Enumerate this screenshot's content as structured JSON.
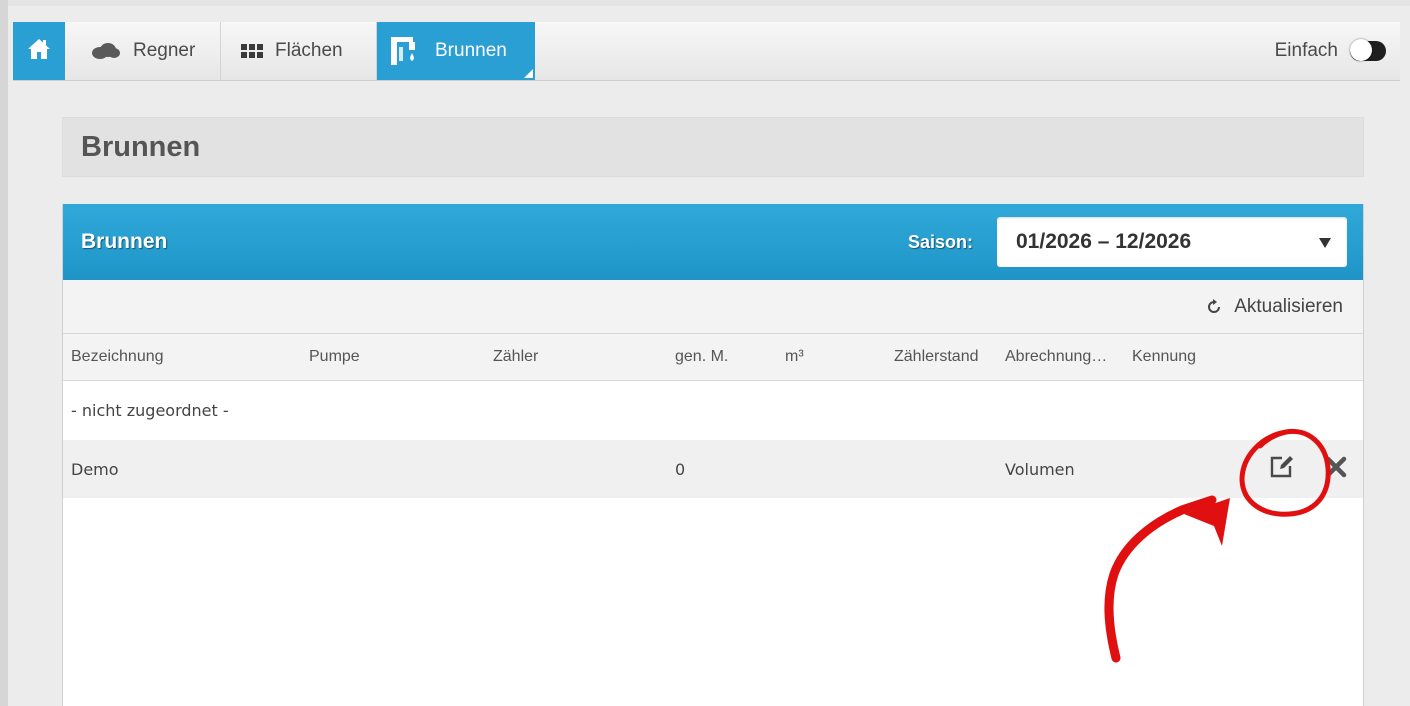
{
  "nav": {
    "items": [
      {
        "label": "Regner",
        "icon": "cloud-icon"
      },
      {
        "label": "Flächen",
        "icon": "grid-icon"
      },
      {
        "label": "Brunnen",
        "icon": "well-icon",
        "active": true
      }
    ],
    "mode_label": "Einfach",
    "accent_color": "#2a9fd4"
  },
  "page": {
    "title": "Brunnen"
  },
  "panel": {
    "title": "Brunnen",
    "season_label": "Saison:",
    "season_value": "01/2026 – 12/2026",
    "refresh_label": "Aktualisieren"
  },
  "table": {
    "columns": [
      "Bezeichnung",
      "Pumpe",
      "Zähler",
      "gen. M.",
      "m³",
      "Zählerstand",
      "Abrechnung…",
      "Kennung"
    ],
    "group_row": "- nicht zugeordnet -",
    "rows": [
      {
        "bezeichnung": "Demo",
        "gen_m": "0",
        "abrechnung": "Volumen"
      }
    ]
  },
  "annotation_color": "#e01010"
}
